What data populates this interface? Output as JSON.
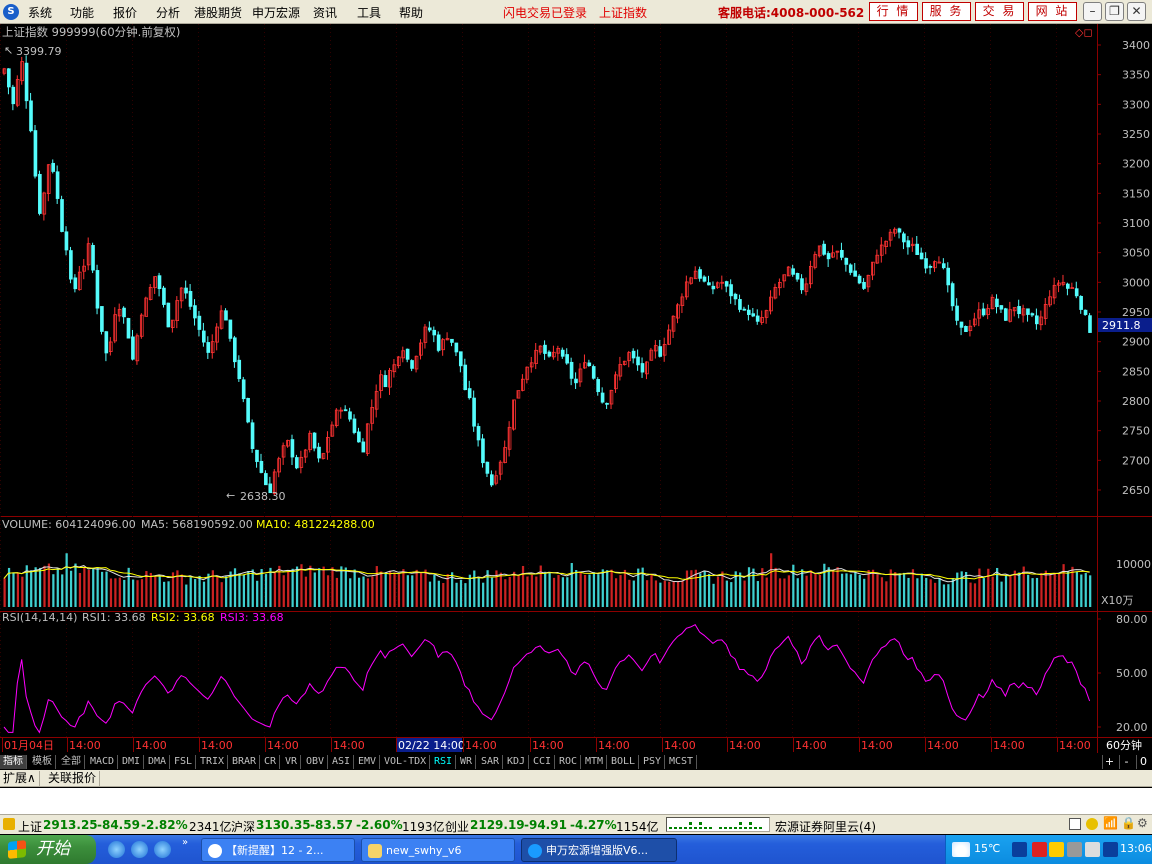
{
  "menubar": {
    "items": [
      "系统",
      "功能",
      "报价",
      "分析",
      "港股期货",
      "申万宏源",
      "资讯",
      "工具",
      "帮助"
    ],
    "status1": "闪电交易已登录",
    "status2": "上证指数",
    "hotline": "客服电话:4008-000-562",
    "right_buttons": [
      "行 情",
      "服 务",
      "交 易",
      "网 站"
    ]
  },
  "chart_header": {
    "title": "上证指数 999999(60分钟.前复权)",
    "max_label": "3399.79",
    "min_label": "2638.30",
    "last_price": "2911.8"
  },
  "price_axis": [
    "3400",
    "3350",
    "3300",
    "3250",
    "3200",
    "3150",
    "3100",
    "3050",
    "3000",
    "2950",
    "2900",
    "2850",
    "2800",
    "2750",
    "2700",
    "2650"
  ],
  "volume_header": {
    "vol": "VOLUME: 604124096.00",
    "ma5": "MA5: 568190592.00",
    "ma10": "MA10: 481224288.00",
    "axis_label": "10000",
    "unit": "X10万"
  },
  "rsi_header": {
    "name": "RSI(14,14,14)",
    "rsi1": "RSI1: 33.68",
    "rsi2": "RSI2: 33.68",
    "rsi3": "RSI3: 33.68",
    "axis": [
      "80.00",
      "50.00",
      "20.00"
    ]
  },
  "time_axis": {
    "labels": [
      "01月04日",
      "14:00",
      "14:00",
      "14:00",
      "14:00",
      "14:00",
      "14:00",
      "02/22 14:00",
      "14:00",
      "14:00",
      "14:00",
      "14:00",
      "14:00",
      "14:00",
      "14:00",
      "14:00",
      "14:00",
      "14:00"
    ],
    "period": "60分钟"
  },
  "chart_data": {
    "type": "candlestick",
    "title": "上证指数 999999(60分钟.前复权)",
    "ylim": [
      2620,
      3420
    ],
    "y_ticks": [
      3400,
      3350,
      3300,
      3250,
      3200,
      3150,
      3100,
      3050,
      3000,
      2950,
      2900,
      2850,
      2800,
      2750,
      2700,
      2650
    ],
    "max": 3399.79,
    "min": 2638.3,
    "last": 2911.8,
    "close_path": [
      3360,
      3330,
      3300,
      3340,
      3370,
      3310,
      3260,
      3180,
      3120,
      3150,
      3200,
      3190,
      3140,
      3090,
      3060,
      3000,
      2990,
      3020,
      3030,
      3060,
      3020,
      2960,
      2920,
      2880,
      2900,
      2950,
      2960,
      2940,
      2910,
      2870,
      2910,
      2950,
      2970,
      2990,
      3010,
      2990,
      2960,
      2930,
      2940,
      2970,
      2990,
      2980,
      2960,
      2940,
      2920,
      2900,
      2880,
      2900,
      2930,
      2950,
      2940,
      2900,
      2870,
      2840,
      2800,
      2760,
      2720,
      2700,
      2680,
      2660,
      2650,
      2680,
      2700,
      2720,
      2730,
      2710,
      2690,
      2700,
      2720,
      2740,
      2720,
      2700,
      2710,
      2740,
      2760,
      2780,
      2790,
      2780,
      2770,
      2750,
      2730,
      2720,
      2760,
      2790,
      2820,
      2840,
      2830,
      2850,
      2860,
      2880,
      2890,
      2870,
      2860,
      2880,
      2900,
      2920,
      2920,
      2910,
      2890,
      2900,
      2910,
      2900,
      2880,
      2860,
      2820,
      2800,
      2760,
      2730,
      2700,
      2680,
      2660,
      2680,
      2700,
      2720,
      2760,
      2800,
      2820,
      2840,
      2860,
      2870,
      2880,
      2890,
      2880,
      2870,
      2880,
      2890,
      2870,
      2860,
      2840,
      2830,
      2850,
      2870,
      2860,
      2840,
      2820,
      2800,
      2800,
      2820,
      2840,
      2860,
      2870,
      2880,
      2870,
      2860,
      2850,
      2860,
      2880,
      2890,
      2880,
      2900,
      2920,
      2940,
      2960,
      2980,
      3000,
      3010,
      3020,
      3010,
      3000,
      2990,
      2990,
      3000,
      3000,
      2990,
      2980,
      2970,
      2960,
      2950,
      2950,
      2940,
      2930,
      2940,
      2950,
      2970,
      2990,
      3000,
      3010,
      3020,
      3010,
      3000,
      2990,
      3000,
      3030,
      3050,
      3060,
      3050,
      3040,
      3050,
      3050,
      3040,
      3030,
      3020,
      3010,
      3000,
      2990,
      3010,
      3030,
      3050,
      3060,
      3070,
      3080,
      3090,
      3080,
      3070,
      3060,
      3060,
      3050,
      3040,
      3030,
      3030,
      3040,
      3040,
      3020,
      2990,
      2960,
      2930,
      2920,
      2920,
      2930,
      2940,
      2950,
      2950,
      2960,
      2970,
      2960,
      2950,
      2940,
      2950,
      2960,
      2950,
      2950,
      2940,
      2940,
      2930,
      2940,
      2960,
      2980,
      2990,
      3000,
      3000,
      2990,
      2990,
      2980,
      2960,
      2940,
      2920
    ],
    "volume_axis": [
      10000
    ],
    "volume_unit": "X10万",
    "volume": 604124096.0,
    "ma5": 568190592.0,
    "ma10": 481224288.0,
    "rsi_axis": [
      80,
      50,
      20
    ],
    "rsi1": 33.68,
    "rsi2": 33.68,
    "rsi3": 33.68
  },
  "tabs": {
    "items": [
      "指标",
      "模板",
      "全部",
      "MACD",
      "DMI",
      "DMA",
      "FSL",
      "TRIX",
      "BRAR",
      "CR",
      "VR",
      "OBV",
      "ASI",
      "EMV",
      "VOL-TDX",
      "RSI",
      "WR",
      "SAR",
      "KDJ",
      "CCI",
      "ROC",
      "MTM",
      "BOLL",
      "PSY",
      "MCST"
    ],
    "active": "RSI",
    "controls": [
      "+",
      "-",
      "0"
    ]
  },
  "ext": {
    "items": [
      "扩展∧",
      "关联报价"
    ]
  },
  "statusbar": {
    "sh_label": "上证",
    "sh_val": "2913.25",
    "sh_chg": "-84.59",
    "sh_pct": "-2.82%",
    "sh_amt": "2341亿",
    "hs_label": "沪深",
    "hs_val": "3130.35",
    "hs_chg": "-83.57",
    "hs_pct": "-2.60%",
    "hs_amt": "1193亿",
    "cy_label": "创业",
    "cy_val": "2129.19",
    "cy_chg": "-94.91",
    "cy_pct": "-4.27%",
    "cy_amt": "1154亿",
    "broker": "宏源证券阿里云(4)"
  },
  "taskbar": {
    "start": "开始",
    "tasks": [
      "【新提醒】12 - 2...",
      "new_swhy_v6",
      "申万宏源增强版V6..."
    ],
    "temp": "15℃",
    "time": "13:06"
  },
  "colors": {
    "up": "#ff3232",
    "down": "#54fcfc",
    "ma10": "#ffff00",
    "rsi": "#ff00ff",
    "grid": "#8b0000"
  }
}
